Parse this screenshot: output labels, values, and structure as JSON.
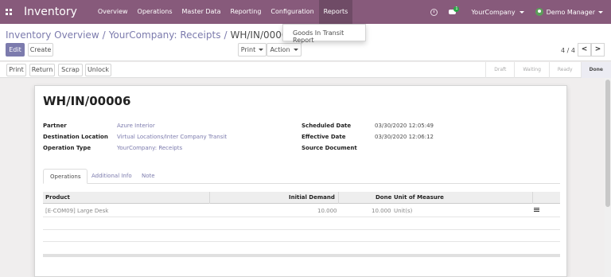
{
  "app": {
    "title": "Inventory"
  },
  "menu": [
    {
      "label": "Overview"
    },
    {
      "label": "Operations"
    },
    {
      "label": "Master Data"
    },
    {
      "label": "Reporting"
    },
    {
      "label": "Configuration"
    },
    {
      "label": "Reports"
    }
  ],
  "nav_right": {
    "chat_count": "1",
    "company": "YourCompany",
    "user": "Demo Manager"
  },
  "dropdown": {
    "item": "Goods In Transit Report"
  },
  "breadcrumb": {
    "part1": "Inventory Overview",
    "part2": "YourCompany: Receipts",
    "current": "WH/IN/00006",
    "sep": "/"
  },
  "toolbar": {
    "edit": "Edit",
    "create": "Create",
    "print": "Print",
    "action": "Action"
  },
  "pager": {
    "value": "4 / 4",
    "prev": "<",
    "next": ">"
  },
  "statusbar": {
    "buttons": [
      "Print",
      "Return",
      "Scrap",
      "Unlock"
    ],
    "stages": [
      "Draft",
      "Waiting",
      "Ready",
      "Done"
    ],
    "active_stage": "Done"
  },
  "record": {
    "name": "WH/IN/00006",
    "left_fields": [
      {
        "label": "Partner",
        "value": "Azure Interior"
      },
      {
        "label": "Destination Location",
        "value": "Virtual Locations/Inter Company Transit"
      },
      {
        "label": "Operation Type",
        "value": "YourCompany: Receipts"
      }
    ],
    "right_fields": [
      {
        "label": "Scheduled Date",
        "value": "03/30/2020 12:05:49"
      },
      {
        "label": "Effective Date",
        "value": "03/30/2020 12:06:12"
      },
      {
        "label": "Source Document",
        "value": ""
      }
    ]
  },
  "tabs": [
    "Operations",
    "Additional Info",
    "Note"
  ],
  "table": {
    "headers": [
      "Product",
      "Initial Demand",
      "Done",
      "Unit of Measure"
    ],
    "rows": [
      {
        "product": "[E-COM09] Large Desk",
        "initial_demand": "10.000",
        "done": "10.000",
        "uom": "Unit(s)"
      }
    ]
  },
  "colors": {
    "navbar": "#875a7b",
    "primary": "#7c7bad"
  }
}
